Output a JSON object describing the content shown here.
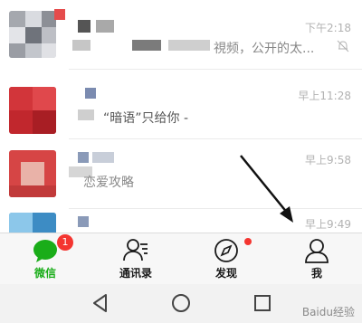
{
  "chats": [
    {
      "time": "下午2:18",
      "preview": "視频，公开的太...",
      "muted": true
    },
    {
      "time": "早上11:28",
      "preview": "“暗语”只给你 -",
      "muted": false
    },
    {
      "time": "早上9:58",
      "preview": "恋爱攻略",
      "muted": false
    },
    {
      "time": "早上9:49",
      "preview": "",
      "muted": false
    }
  ],
  "tabbar": {
    "tabs": [
      {
        "label": "微信",
        "icon": "chat-bubble-icon",
        "badge": "1",
        "active": true
      },
      {
        "label": "通讯录",
        "icon": "contacts-icon",
        "active": false
      },
      {
        "label": "发现",
        "icon": "compass-icon",
        "dot": true,
        "active": false
      },
      {
        "label": "我",
        "icon": "person-icon",
        "active": false
      }
    ]
  },
  "navbar": {
    "buttons": [
      "back-icon",
      "home-icon",
      "recents-icon"
    ]
  },
  "watermark": "Baidu经验",
  "colors": {
    "active_green": "#1aad19",
    "badge_red": "#f43530",
    "time_gray": "#b2b2b2"
  }
}
